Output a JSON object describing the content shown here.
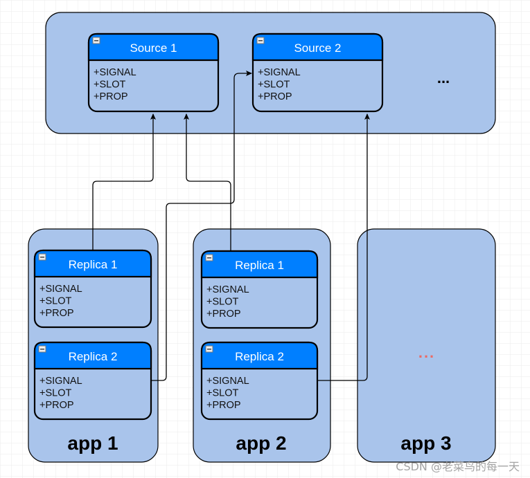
{
  "colors": {
    "container": "#A9C4EB",
    "header": "#007FFF",
    "border": "#000000",
    "ellipsis_red": "#EA6B66",
    "grid": "#E8E8E8"
  },
  "sources": [
    {
      "title": "Source 1",
      "members": [
        "+SIGNAL",
        "+SLOT",
        "+PROP"
      ]
    },
    {
      "title": "Source 2",
      "members": [
        "+SIGNAL",
        "+SLOT",
        "+PROP"
      ]
    }
  ],
  "source_more": "...",
  "apps": [
    {
      "label": "app 1",
      "replicas": [
        {
          "title": "Replica 1",
          "members": [
            "+SIGNAL",
            "+SLOT",
            "+PROP"
          ]
        },
        {
          "title": "Replica 2",
          "members": [
            "+SIGNAL",
            "+SLOT",
            "+PROP"
          ]
        }
      ]
    },
    {
      "label": "app 2",
      "replicas": [
        {
          "title": "Replica 1",
          "members": [
            "+SIGNAL",
            "+SLOT",
            "+PROP"
          ]
        },
        {
          "title": "Replica 2",
          "members": [
            "+SIGNAL",
            "+SLOT",
            "+PROP"
          ]
        }
      ]
    },
    {
      "label": "app 3",
      "more": "..."
    }
  ],
  "watermark": "CSDN @老菜鸟的每一天"
}
